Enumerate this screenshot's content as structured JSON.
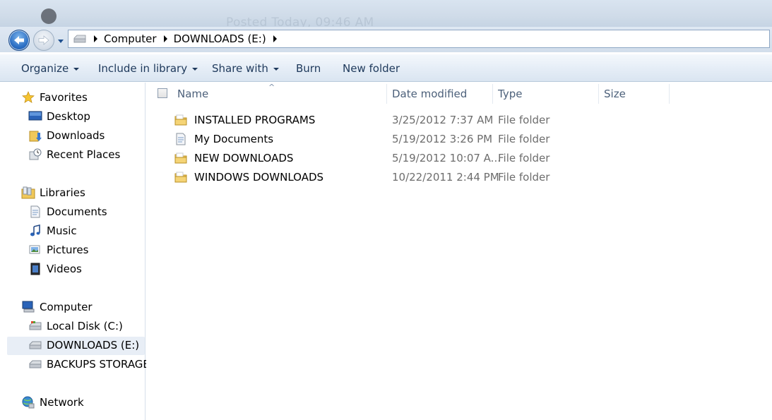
{
  "background": {
    "blurred_text": "Posted Today, 09:46 AM"
  },
  "address": {
    "crumbs": [
      "Computer",
      "DOWNLOADS (E:)"
    ]
  },
  "toolbar": {
    "organize": "Organize",
    "include_in_library": "Include in library",
    "share_with": "Share with",
    "burn": "Burn",
    "new_folder": "New folder"
  },
  "sidebar": {
    "favorites": "Favorites",
    "desktop": "Desktop",
    "downloads": "Downloads",
    "recent_places": "Recent Places",
    "libraries": "Libraries",
    "documents": "Documents",
    "music": "Music",
    "pictures": "Pictures",
    "videos": "Videos",
    "computer": "Computer",
    "local_disk": "Local Disk (C:)",
    "downloads_drive": "DOWNLOADS (E:)",
    "backups_storage": "BACKUPS STORAGE (",
    "network": "Network"
  },
  "columns": {
    "name": "Name",
    "date_modified": "Date modified",
    "type": "Type",
    "size": "Size"
  },
  "files": [
    {
      "name": "INSTALLED PROGRAMS",
      "date": "3/25/2012 7:37 AM",
      "type": "File folder",
      "icon": "folder-icon"
    },
    {
      "name": "My Documents",
      "date": "5/19/2012 3:26 PM",
      "type": "File folder",
      "icon": "documents-folder-icon"
    },
    {
      "name": "NEW DOWNLOADS",
      "date": "5/19/2012 10:07 A...",
      "type": "File folder",
      "icon": "folder-icon"
    },
    {
      "name": "WINDOWS DOWNLOADS",
      "date": "10/22/2011 2:44 PM",
      "type": "File folder",
      "icon": "folder-icon"
    }
  ],
  "colors": {
    "accent": "#2c6fc4",
    "toolbar_text": "#1e395b",
    "selection": "#e8eef6",
    "folder": "#f0c85a"
  }
}
